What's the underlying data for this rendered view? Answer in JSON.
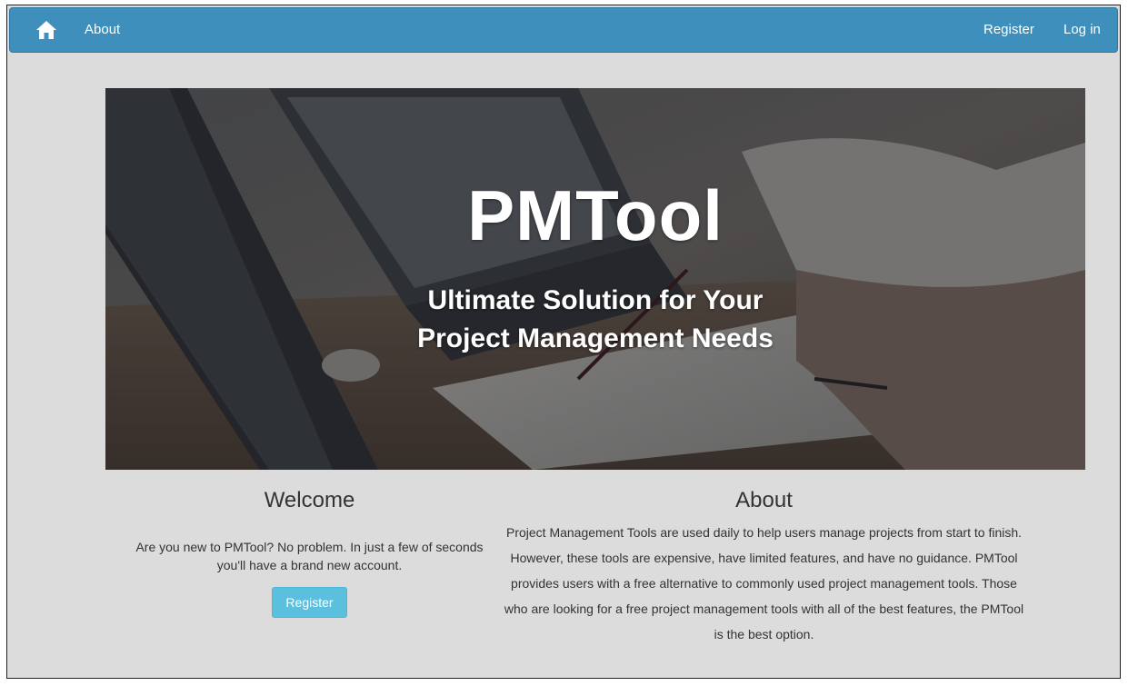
{
  "navbar": {
    "home_icon": "home-icon",
    "about_label": "About",
    "register_label": "Register",
    "login_label": "Log in",
    "color": "#3f8fbd"
  },
  "hero": {
    "title": "PMTool",
    "subtitle_line1": "Ultimate Solution for Your",
    "subtitle_line2": "Project Management Needs"
  },
  "welcome": {
    "heading": "Welcome",
    "text": "Are you new to PMTool? No problem. In just a few of seconds you'll have a brand new account.",
    "button_label": "Register",
    "button_color": "#5bc0de"
  },
  "about": {
    "heading": "About",
    "text": "Project Management Tools are used daily to help users manage projects from start to finish. However, these tools are expensive, have limited features, and have no guidance. PMTool provides users with a free alternative to commonly used project management tools. Those who are looking for a free project management tools with all of the best features, the PMTool is the best option."
  }
}
